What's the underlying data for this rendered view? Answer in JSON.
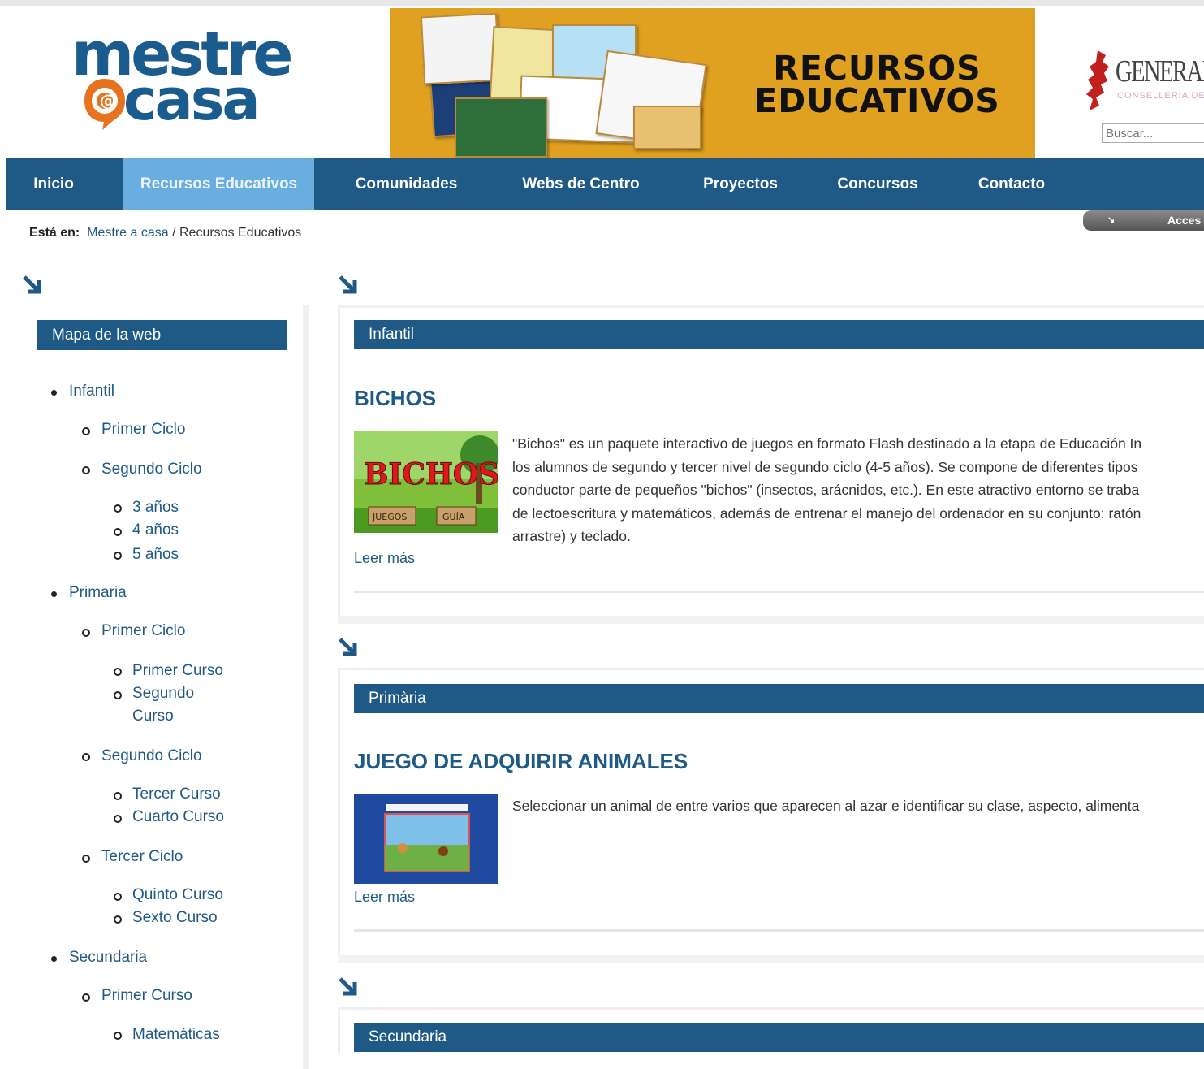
{
  "header": {
    "logo_line1": "mestre",
    "logo_at": "@",
    "logo_line2": "casa",
    "banner_title_1": "RECURSOS",
    "banner_title_2": "EDUCATIVOS",
    "gen_text": "GENERAL",
    "gen_sub": "CONSELLERIA DE",
    "search_placeholder": "Buscar..."
  },
  "nav": {
    "items": [
      {
        "label": "Inicio"
      },
      {
        "label": "Recursos Educativos"
      },
      {
        "label": "Comunidades"
      },
      {
        "label": "Webs de Centro"
      },
      {
        "label": "Proyectos"
      },
      {
        "label": "Concursos"
      },
      {
        "label": "Contacto"
      }
    ],
    "active_index": 1,
    "acceso": "Acces"
  },
  "breadcrumb": {
    "prefix": "Está en:",
    "home": "Mestre a casa",
    "separator": "/",
    "current": "Recursos Educativos"
  },
  "sidebar": {
    "title": "Mapa de la web",
    "tree": [
      "Infantil",
      "Primer Ciclo",
      "Segundo Ciclo",
      "3 años",
      "4 años",
      "5 años",
      "Primaria",
      "Primer Ciclo",
      "Primer Curso",
      "Segundo",
      "Curso",
      "Segundo Ciclo",
      "Tercer Curso",
      "Cuarto Curso",
      "Tercer Ciclo",
      "Quinto Curso",
      "Sexto Curso",
      "Secundaria",
      "Primer Curso",
      "Matemáticas"
    ]
  },
  "sections": [
    {
      "bar": "Infantil",
      "title": "BICHOS",
      "thumb_top": "BICHOS",
      "thumb_btn1": "JUEGOS",
      "thumb_btn2": "GUÍA",
      "desc": [
        "\"Bichos\" es un paquete interactivo de juegos en formato Flash destinado a la etapa de Educación In",
        "los alumnos de segundo y tercer nivel de segundo ciclo (4-5 años). Se compone de diferentes tipos",
        "conductor parte de pequeños \"bichos\" (insectos, arácnidos, etc.). En este atractivo entorno se traba",
        "de lectoescritura y matemáticos, además de entrenar el manejo del ordenador en su conjunto: ratón",
        "arrastre) y teclado."
      ],
      "more": "Leer más"
    },
    {
      "bar": "Primària",
      "title": "JUEGO DE ADQUIRIR ANIMALES",
      "desc": [
        "Seleccionar un animal de entre varios que aparecen al azar e identificar su clase, aspecto, alimenta"
      ],
      "more": "Leer más"
    },
    {
      "bar": "Secundaria"
    }
  ],
  "colors": {
    "primary": "#1f5a86",
    "nav_active": "#6aaee0",
    "banner": "#e0a020",
    "logo_orange": "#e8731e"
  }
}
